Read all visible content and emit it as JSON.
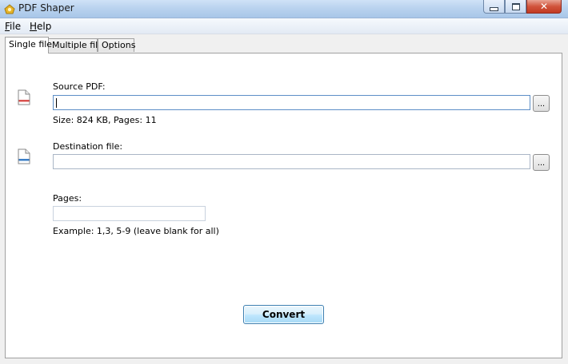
{
  "window": {
    "title": "PDF Shaper"
  },
  "menu": {
    "items": [
      {
        "label": "File",
        "underline": "F",
        "rest": "ile"
      },
      {
        "label": "Help",
        "underline": "H",
        "rest": "elp"
      }
    ]
  },
  "tabs": [
    {
      "label": "Single file",
      "active": true
    },
    {
      "label": "Multiple files",
      "active": false
    },
    {
      "label": "Options",
      "active": false
    }
  ],
  "source": {
    "label": "Source PDF:",
    "value": "",
    "info": "Size: 824 KB, Pages: 11",
    "browse_label": "..."
  },
  "destination": {
    "label": "Destination file:",
    "value": "",
    "browse_label": "..."
  },
  "pages": {
    "label": "Pages:",
    "value": "",
    "hint": "Example: 1,3, 5-9 (leave blank for all)"
  },
  "convert_label": "Convert",
  "colors": {
    "source_icon_accent": "#d9534f",
    "destination_icon_accent": "#3d7fc6",
    "convert_border": "#3c7fb1"
  }
}
